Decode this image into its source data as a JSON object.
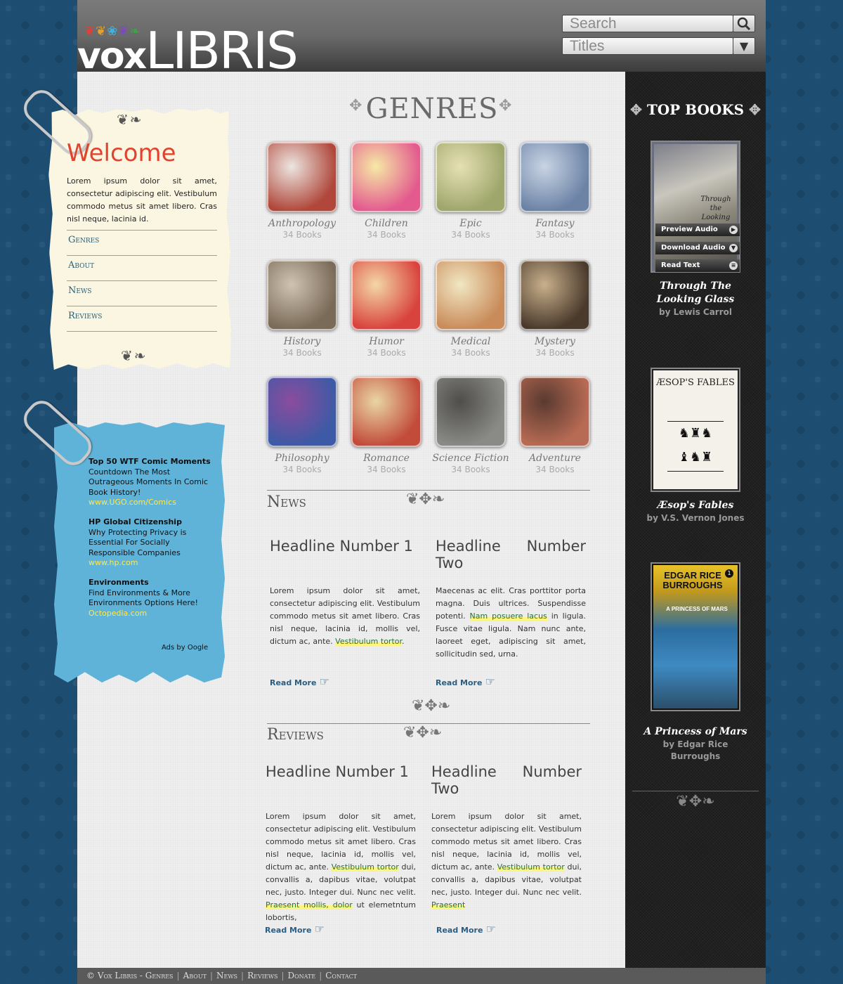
{
  "header": {
    "logo_vox": "vox",
    "logo_libris": "LIBRIS",
    "search_placeholder": "Search",
    "titles_select": "Titles"
  },
  "welcome": {
    "title": "Welcome",
    "text": "Lorem ipsum dolor sit amet, consectetur adipiscing elit. Vestibulum commodo metus sit amet libero. Cras nisl neque, lacinia id.",
    "nav": [
      "Genres",
      "About",
      "News",
      "Reviews"
    ]
  },
  "ads": {
    "items": [
      {
        "title": "Top 50 WTF Comic Moments",
        "desc": "Countdown The Most Outrageous Moments In Comic Book History!",
        "link": "www.UGO.com/Comics"
      },
      {
        "title": "HP Global Citizenship",
        "desc": "Why Protecting Privacy is Essential For Socially Responsible Companies",
        "link": "www.hp.com"
      },
      {
        "title": "Environments",
        "desc": "Find Environments & More Environments Options Here!",
        "link": "Octopedia.com"
      }
    ],
    "ads_by": "Ads by Oogle"
  },
  "genres": {
    "title": "GENRES",
    "items": [
      {
        "name": "Anthropology",
        "count": "34 Books",
        "color1": "#b0473a",
        "color2": "#ece6e1"
      },
      {
        "name": "Children",
        "count": "34 Books",
        "color1": "#e35a8e",
        "color2": "#f6e9a6"
      },
      {
        "name": "Epic",
        "count": "34 Books",
        "color1": "#9ea66b",
        "color2": "#e6e0b4"
      },
      {
        "name": "Fantasy",
        "count": "34 Books",
        "color1": "#6c83a6",
        "color2": "#c9d4e4"
      },
      {
        "name": "History",
        "count": "34 Books",
        "color1": "#7a6a58",
        "color2": "#cfc3b2"
      },
      {
        "name": "Humor",
        "count": "34 Books",
        "color1": "#d9433d",
        "color2": "#f3d7a6"
      },
      {
        "name": "Medical",
        "count": "34 Books",
        "color1": "#c98b5a",
        "color2": "#f1e7c3"
      },
      {
        "name": "Mystery",
        "count": "34 Books",
        "color1": "#4a3a2c",
        "color2": "#c9b08c"
      },
      {
        "name": "Philosophy",
        "count": "34 Books",
        "color1": "#3d5aa6",
        "color2": "#8b4c9e"
      },
      {
        "name": "Romance",
        "count": "34 Books",
        "color1": "#c24b3a",
        "color2": "#e9d6a4"
      },
      {
        "name": "Science Fiction",
        "count": "34 Books",
        "color1": "#8a8a86",
        "color2": "#4f4e4a"
      },
      {
        "name": "Adventure",
        "count": "34 Books",
        "color1": "#b86b54",
        "color2": "#5a3a30"
      }
    ]
  },
  "news": {
    "heading": "News",
    "articles": [
      {
        "headline": "Headline Number 1",
        "before": "Lorem ipsum dolor sit amet, consectetur adipiscing elit. Vestibulum commodo metus sit amet libero. Cras nisl neque, lacinia id, mollis vel, dictum ac, ante. ",
        "hl1": "Vestibulum tortor",
        "after": ".",
        "read_more": "Read More"
      },
      {
        "headline": "Headline Number Two",
        "before": "Maecenas ac elit. Cras porttitor porta magna. Duis ultrices. Suspendisse potenti. ",
        "hl1": "Nam posuere lacus",
        "after": " in ligula. Fusce vitae ligula. Nam nunc ante, laoreet eget, adipiscing sit amet, sollicitudin sed, urna.",
        "read_more": "Read More"
      }
    ]
  },
  "reviews": {
    "heading": "Reviews",
    "articles": [
      {
        "headline": "Headline Number 1",
        "before": "Lorem ipsum dolor sit amet, consectetur adipiscing elit. Vestibulum commodo metus sit amet libero. Cras nisl neque, lacinia id, mollis vel, dictum ac, ante. ",
        "hl1": "Vestibulum tortor",
        "mid": " dui, convallis a, dapibus vitae, volutpat nec, justo. Integer dui. Nunc nec velit. ",
        "hl2": "Praesent mollis, dolor",
        "after": " ut elemetntum lobortis,",
        "read_more": "Read More"
      },
      {
        "headline": "Headline Number Two",
        "before": "Lorem ipsum dolor sit amet, consectetur adipiscing elit. Vestibulum commodo metus sit amet libero. Cras nisl neque, lacinia id, mollis vel, dictum ac, ante. ",
        "hl1": "Vestibulum tortor",
        "mid": " dui, convallis a, dapibus vitae, volutpat nec, justo. Integer dui. Nunc nec velit. ",
        "hl2": "Praesent",
        "after": "",
        "read_more": "Read More"
      }
    ]
  },
  "top_books": {
    "title": "TOP BOOKS",
    "books": [
      {
        "title_line1": "Through The",
        "title_line2": "Looking Glass",
        "author": "by Lewis Carrol",
        "preview_audio": "Preview Audio",
        "download_audio": "Download Audio",
        "read_text": "Read Text",
        "cover_text": "Through the Looking"
      },
      {
        "title_line1": "Æsop's Fables",
        "title_line2": "",
        "author": "by V.S. Vernon Jones",
        "cover_text": "ÆSOP'S FABLES"
      },
      {
        "title_line1": "A Princess of Mars",
        "title_line2": "",
        "author": "by Edgar Rice Burroughs",
        "cover_brand": "EDGAR RICE BURROUGHS",
        "cover_sub": "A PRINCESS OF MARS"
      }
    ]
  },
  "footer": {
    "copyright": "© Vox Libris - Genres",
    "links": [
      "About",
      "News",
      "Reviews",
      "Donate",
      "Contact"
    ]
  }
}
